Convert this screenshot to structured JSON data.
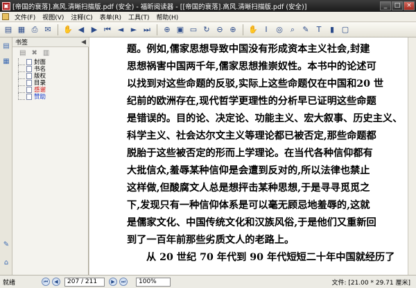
{
  "window": {
    "title": "[帝国的衰落].高风.清晰扫描版.pdf (安全) - 福昕阅读器 - [[帝国的衰落].高风.清晰扫描版.pdf (安全)]",
    "app_icon": "pdf-reader-icon",
    "buttons": [
      "_",
      "□",
      "×"
    ]
  },
  "menu": {
    "items": [
      "文件(F)",
      "视图(V)",
      "注释(C)",
      "表单(R)",
      "工具(T)",
      "帮助(H)"
    ]
  },
  "sidebar": {
    "header": "书签",
    "bookmarks": [
      {
        "label": "封面",
        "color": "#000000"
      },
      {
        "label": "书名",
        "color": "#000000"
      },
      {
        "label": "版权",
        "color": "#000000"
      },
      {
        "label": "目录",
        "color": "#000000"
      },
      {
        "label": "感谢",
        "color": "#d01010"
      },
      {
        "label": "赞助",
        "color": "#1b3fd0"
      }
    ]
  },
  "document": {
    "lines": [
      "题。例如,儒家思想导致中国没有形成资本主义社会,封建",
      "思想祸害中国两千年,儒家思想推崇奴性。本书中的论述可",
      "以找到对这些命题的反驳,实际上这些命题仅在中国和20 世",
      "纪前的欧洲存在,现代哲学更理性的分析早已证明这些命题",
      "是错误的。目的论、决定论、功能主义、宏大叙事、历史主义、",
      "科学主义、社会达尔文主义等理论都已被否定,那些命题都",
      "脱胎于这些被否定的形而上学理论。在当代各种信仰都有",
      "大批信众,羞辱某种信仰是会遭到反对的,所以法律也禁止",
      "这样做,但酸腐文人总是想抨击某种思想,于是寻寻觅觅之",
      "下,发现只有一种信仰体系是可以毫无顾忌地羞辱的,这就",
      "是儒家文化、中国传统文化和汉族风俗,于是他们又重新回",
      "到了一百年前那些劣质文人的老路上。",
      "从 20 世纪 70 年代到 90 年代短短二十年中国就经历了"
    ]
  },
  "status": {
    "ready": "就绪",
    "page": "207 / 211",
    "zoom": "100%",
    "file_size": "文件: [21.00 * 29.71 厘米]"
  }
}
